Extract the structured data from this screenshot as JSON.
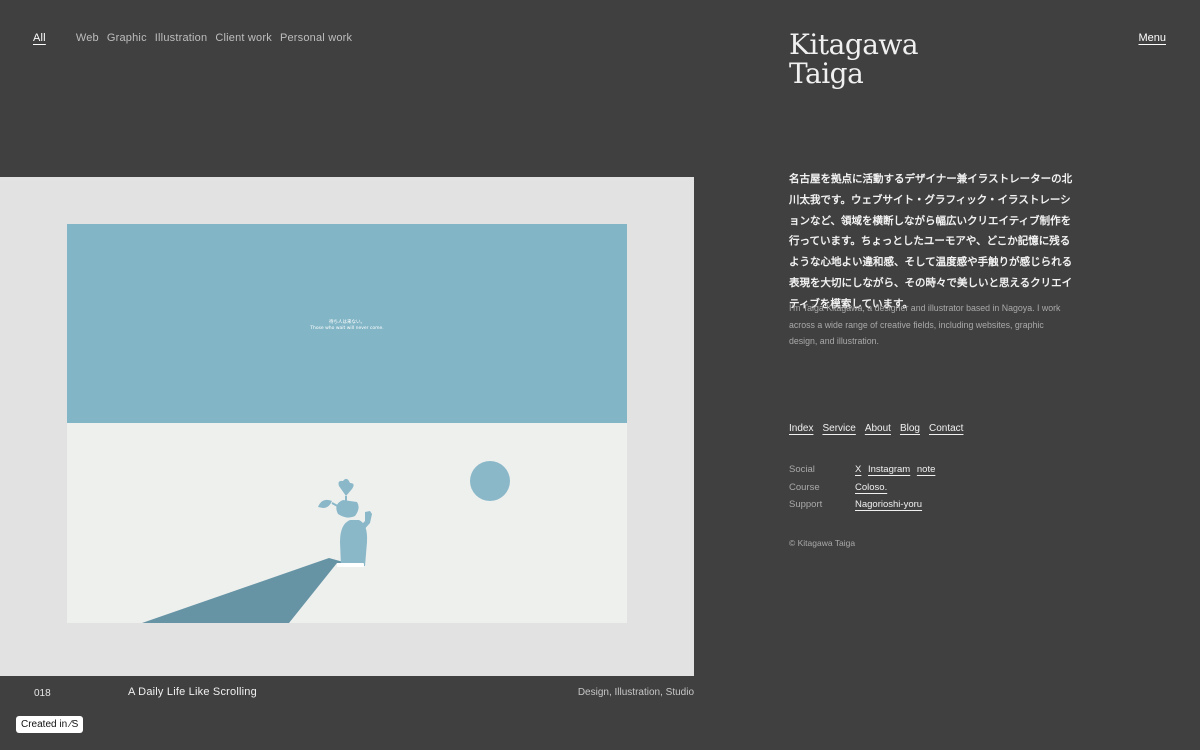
{
  "filters": {
    "all": "All",
    "items": [
      "Web",
      "Graphic",
      "Illustration",
      "Client work",
      "Personal work"
    ]
  },
  "logo": {
    "line1": "Kitagawa",
    "line2": "Taiga"
  },
  "menu_label": "Menu",
  "intro": {
    "ja": "名古屋を拠点に活動するデザイナー兼イラストレーターの北川太我です。ウェブサイト・グラフィック・イラストレーションなど、領域を横断しながら幅広いクリエイティブ制作を行っています。ちょっとしたユーモアや、どこか記憶に残るような心地よい違和感、そして温度感や手触りが感じられる表現を大切にしながら、その時々で美しいと思えるクリエイティブを模索しています。",
    "en": "I'm Taiga Kitagawa, a designer and illustrator based in Nagoya. I work across a wide range of creative fields, including websites, graphic design, and illustration."
  },
  "nav": [
    "Index",
    "Service",
    "About",
    "Blog",
    "Contact"
  ],
  "links": {
    "social": {
      "label": "Social",
      "items": [
        "X",
        "Instagram",
        "note"
      ]
    },
    "course": {
      "label": "Course",
      "items": [
        "Coloso."
      ]
    },
    "support": {
      "label": "Support",
      "items": [
        "Nagorioshi-yoru"
      ]
    }
  },
  "copyright": "© Kitagawa Taiga",
  "work": {
    "number": "018",
    "title": "A Daily Life Like Scrolling",
    "tags": "Design, Illustration, Studio",
    "art_text_ja": "待ち人は来ない。",
    "art_text_en": "Those who wait will never come.",
    "colors": {
      "sky": "#82b5c6",
      "ground": "#eef0ee",
      "figure": "#8ab8c9",
      "shadow": "#6694a5"
    }
  },
  "badge": "Created in ⁄S"
}
